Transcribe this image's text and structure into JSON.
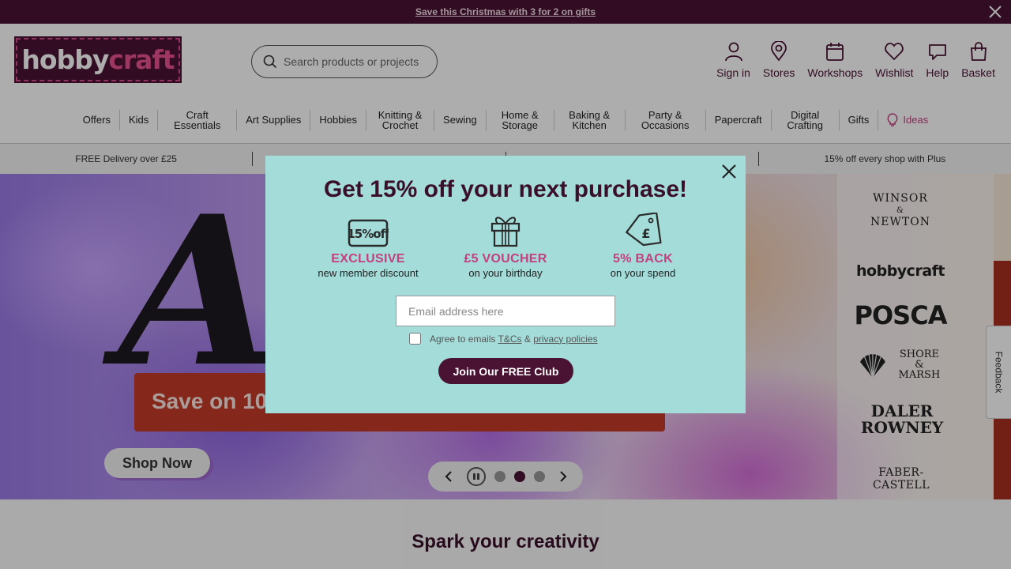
{
  "promo": {
    "text": "Save this Christmas with 3 for 2 on gifts"
  },
  "header": {
    "logo": {
      "part1": "hobby",
      "part2": "craft"
    },
    "search_placeholder": "Search products or projects",
    "nav": [
      {
        "label": "Sign in",
        "icon": "user-icon"
      },
      {
        "label": "Stores",
        "icon": "location-pin-icon"
      },
      {
        "label": "Workshops",
        "icon": "calendar-icon"
      },
      {
        "label": "Wishlist",
        "icon": "heart-icon"
      },
      {
        "label": "Help",
        "icon": "chat-bubble-icon"
      },
      {
        "label": "Basket",
        "icon": "shopping-bag-icon"
      }
    ]
  },
  "categories": [
    "Offers",
    "Kids",
    "Craft Essentials",
    "Art Supplies",
    "Hobbies",
    "Knitting & Crochet",
    "Sewing",
    "Home & Storage",
    "Baking & Kitchen",
    "Party & Occasions",
    "Papercraft",
    "Digital Crafting",
    "Gifts",
    "Ideas"
  ],
  "usp": [
    "FREE Delivery over £25",
    "",
    "",
    "15% off every shop with Plus"
  ],
  "hero": {
    "big_text": "Ar",
    "banner_text": "Save on 10",
    "cta": "Shop Now",
    "carousel": {
      "slides": 3,
      "active": 2
    },
    "brands": {
      "winsor": [
        "WINSOR",
        "&",
        "NEWTON"
      ],
      "hobbycraft": "hobbycraft",
      "posca": "POSCA",
      "shore": [
        "SHORE",
        "& MARSH"
      ],
      "daler": [
        "DALER",
        "ROWNEY"
      ],
      "faber": "FABER-CASTELL"
    }
  },
  "section_title": "Spark your creativity",
  "feedback_label": "Feedback",
  "modal": {
    "title": "Get 15% off your next purchase!",
    "perks": [
      {
        "icon": "percent-badge-icon",
        "badge_text": "15%off",
        "title": "EXCLUSIVE",
        "subtitle": "new member discount"
      },
      {
        "icon": "gift-icon",
        "title": "£5 VOUCHER",
        "subtitle": "on your birthday"
      },
      {
        "icon": "price-tag-icon",
        "title": "5% BACK",
        "subtitle": "on your spend"
      }
    ],
    "email_placeholder": "Email address here",
    "agree": {
      "prefix": "Agree to emails",
      "terms": "T&Cs",
      "and": "&",
      "privacy": "privacy policies"
    },
    "cta": "Join Our FREE Club"
  },
  "colors": {
    "brand": "#4a1233",
    "accent": "#c43f7f",
    "modal_bg": "#a3dcd9"
  }
}
